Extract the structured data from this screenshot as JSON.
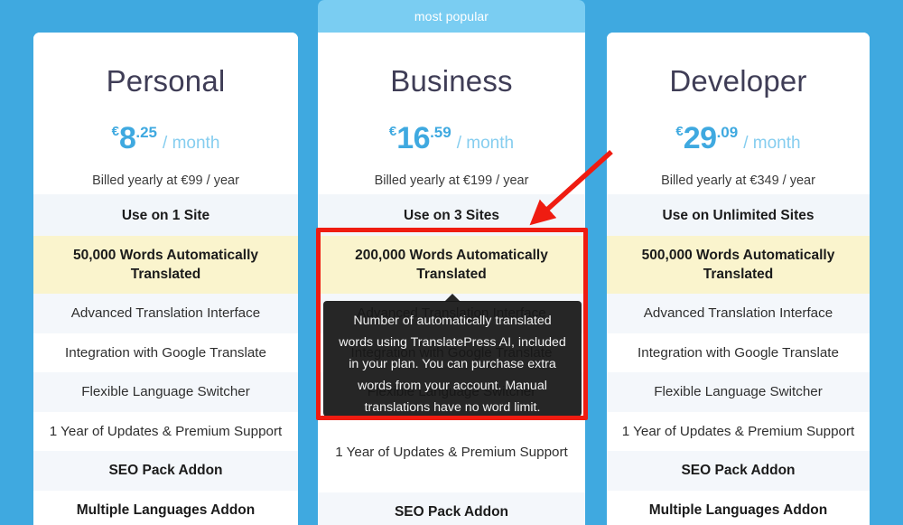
{
  "page": {
    "background_color": "#3fa9e0",
    "accent_color": "#3fa9e0",
    "highlight_row_color": "#faf4cd",
    "annotation_color": "#ef1c11"
  },
  "plans": [
    {
      "name": "Personal",
      "currency": "€",
      "amount": "8",
      "cents": ".25",
      "per": "/ month",
      "billed": "Billed yearly at €99 / year",
      "sites": "Use on 1 Site",
      "words": "50,000 Words Automatically Translated",
      "features": [
        "Advanced Translation Interface",
        "Integration with Google Translate",
        "Flexible Language Switcher",
        "1 Year of Updates & Premium Support",
        "SEO Pack Addon",
        "Multiple Languages Addon"
      ]
    },
    {
      "name": "Business",
      "badge": "most popular",
      "currency": "€",
      "amount": "16",
      "cents": ".59",
      "per": "/ month",
      "billed": "Billed yearly at €199 / year",
      "sites": "Use on 3 Sites",
      "words": "200,000 Words Automatically Translated",
      "features": [
        "Advanced Translation Interface",
        "Integration with Google Translate",
        "Flexible Language Switcher",
        "1 Year of Updates & Premium Support",
        "SEO Pack Addon"
      ]
    },
    {
      "name": "Developer",
      "currency": "€",
      "amount": "29",
      "cents": ".09",
      "per": "/ month",
      "billed": "Billed yearly at €349 / year",
      "sites": "Use on Unlimited Sites",
      "words": "500,000 Words Automatically Translated",
      "features": [
        "Advanced Translation Interface",
        "Integration with Google Translate",
        "Flexible Language Switcher",
        "1 Year of Updates & Premium Support",
        "SEO Pack Addon",
        "Multiple Languages Addon"
      ]
    }
  ],
  "tooltip": {
    "text": "Number of automatically translated words using TranslatePress AI, included in your plan. You can purchase extra words from your account. Manual translations have no word limit."
  }
}
